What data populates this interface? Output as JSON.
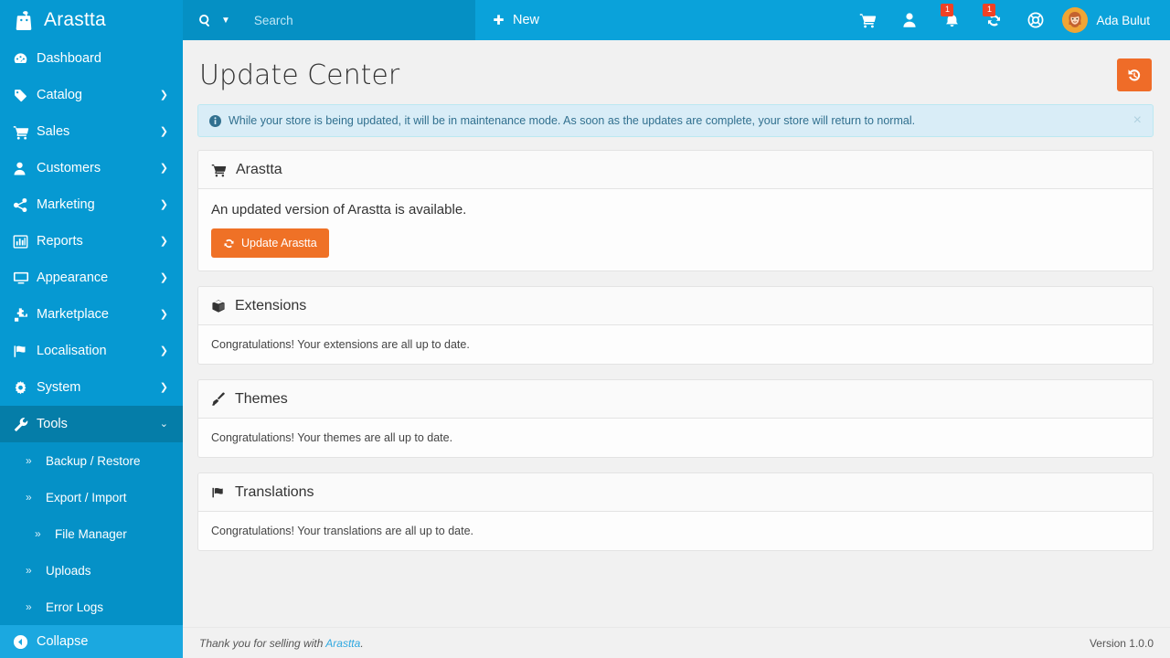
{
  "brand": {
    "name": "Arastta",
    "logo_icon": "arastta-bag-icon"
  },
  "sidebar": {
    "items": [
      {
        "label": "Dashboard",
        "icon": "dashboard-gauge-icon",
        "caret": false,
        "active": false
      },
      {
        "label": "Catalog",
        "icon": "tag-icon",
        "caret": true,
        "active": false
      },
      {
        "label": "Sales",
        "icon": "cart-icon",
        "caret": true,
        "active": false
      },
      {
        "label": "Customers",
        "icon": "user-icon",
        "caret": true,
        "active": false
      },
      {
        "label": "Marketing",
        "icon": "share-icon",
        "caret": true,
        "active": false
      },
      {
        "label": "Reports",
        "icon": "bar-chart-icon",
        "caret": true,
        "active": false
      },
      {
        "label": "Appearance",
        "icon": "monitor-icon",
        "caret": true,
        "active": false
      },
      {
        "label": "Marketplace",
        "icon": "puzzle-icon",
        "caret": true,
        "active": false
      },
      {
        "label": "Localisation",
        "icon": "flag-icon",
        "caret": true,
        "active": false
      },
      {
        "label": "System",
        "icon": "gear-icon",
        "caret": true,
        "active": false
      },
      {
        "label": "Tools",
        "icon": "wrench-icon",
        "caret": true,
        "active": true
      }
    ],
    "submenu": [
      {
        "label": "Backup / Restore",
        "level": 1
      },
      {
        "label": "Export / Import",
        "level": 1
      },
      {
        "label": "File Manager",
        "level": 2
      },
      {
        "label": "Uploads",
        "level": 1
      },
      {
        "label": "Error Logs",
        "level": 1
      }
    ],
    "collapse_label": "Collapse",
    "collapse_icon": "collapse-left-icon"
  },
  "topbar": {
    "search_placeholder": "Search",
    "search_value": "",
    "search_icon": "search-icon",
    "search_caret_icon": "caret-down-icon",
    "new_label": "New",
    "new_icon": "plus-icon",
    "icons": [
      {
        "name": "cart-icon",
        "badge": ""
      },
      {
        "name": "user-icon",
        "badge": ""
      },
      {
        "name": "bell-icon",
        "badge": "1"
      },
      {
        "name": "sync-icon",
        "badge": "1"
      },
      {
        "name": "lifebuoy-icon",
        "badge": ""
      }
    ],
    "user_name": "Ada Bulut",
    "avatar_icon": "user-avatar"
  },
  "page": {
    "title": "Update Center",
    "history_button_icon": "history-undo-icon",
    "alert": {
      "icon": "info-circle-icon",
      "text": "While your store is being updated, it will be in maintenance mode. As soon as the updates are complete, your store will return to normal.",
      "close_label": "×"
    },
    "panels": [
      {
        "title": "Arastta",
        "icon": "cart-icon",
        "body_text": "An updated version of Arastta is available.",
        "body_big": true,
        "button": {
          "label": "Update Arastta",
          "icon": "refresh-icon"
        }
      },
      {
        "title": "Extensions",
        "icon": "cube-icon",
        "body_text": "Congratulations! Your extensions are all up to date.",
        "body_big": false,
        "button": null
      },
      {
        "title": "Themes",
        "icon": "paintbrush-icon",
        "body_text": "Congratulations! Your themes are all up to date.",
        "body_big": false,
        "button": null
      },
      {
        "title": "Translations",
        "icon": "flag-icon",
        "body_text": "Congratulations! Your translations are all up to date.",
        "body_big": false,
        "button": null
      }
    ]
  },
  "footer": {
    "text_before": "Thank you for selling with ",
    "link": "Arastta",
    "text_after": ".",
    "version": "Version 1.0.0"
  },
  "colors": {
    "sidebar": "#0699d2",
    "sidebar_active": "#057da8",
    "submenu": "#0591c7",
    "collapse": "#1ba8e0",
    "topbar": "#0aa2da",
    "search_zone": "#0590c4",
    "accent_orange": "#ef7126",
    "badge_red": "#f04124",
    "alert_bg": "#d9edf7",
    "alert_border": "#bce8f1",
    "alert_text": "#31708f",
    "content_bg": "#f1f1f1",
    "link_blue": "#2fa8e0"
  }
}
